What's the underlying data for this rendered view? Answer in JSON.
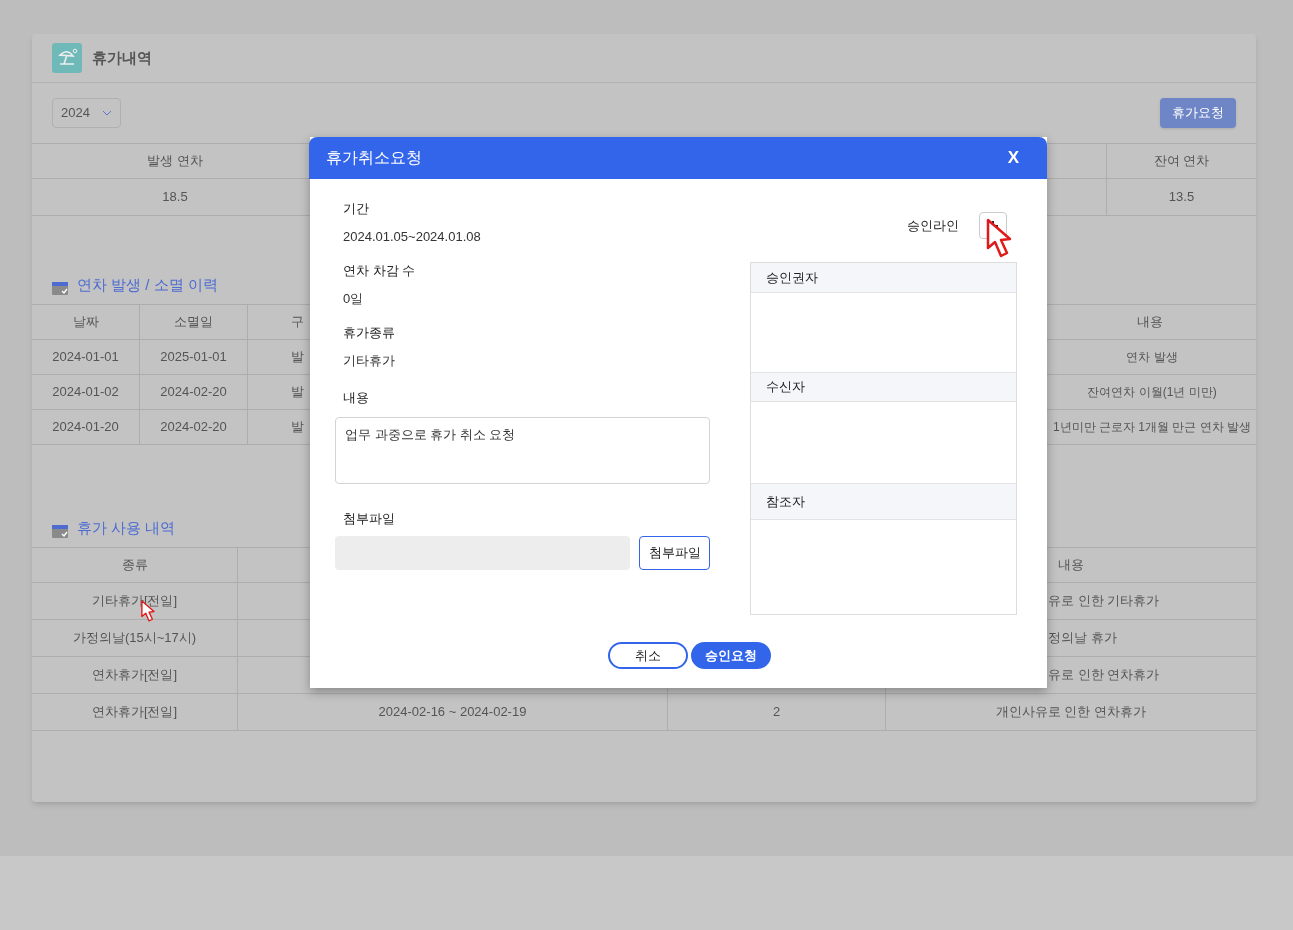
{
  "page": {
    "title": "휴가내역",
    "year": "2024",
    "request_button": "휴가요청"
  },
  "summary": {
    "first_header": "발생 연차",
    "first_value": "18.5",
    "last_header": "잔여 연차",
    "last_value": "13.5"
  },
  "history": {
    "title": "연차 발생 / 소멸 이력",
    "columns": [
      "날짜",
      "소멸일",
      "구"
    ],
    "last_column": "내용",
    "rows": [
      {
        "date": "2024-01-01",
        "expiry": "2025-01-01",
        "type": "발",
        "content": "연차 발생"
      },
      {
        "date": "2024-01-02",
        "expiry": "2024-02-20",
        "type": "발",
        "content": "잔여연차 이월(1년 미만)"
      },
      {
        "date": "2024-01-20",
        "expiry": "2024-02-20",
        "type": "발",
        "content": "1년미만 근로자 1개월 만근 연차 발생"
      }
    ]
  },
  "usage": {
    "title": "휴가 사용 내역",
    "first_column": "종류",
    "last_column": "내용",
    "rows": [
      {
        "type": "기타휴가[전일]",
        "content": "유로 인한 기타휴가"
      },
      {
        "type": "가정의날(15시~17시)",
        "content": "정의날 휴가"
      },
      {
        "type": "연차휴가[전일]",
        "content": "유로 인한 연차휴가"
      },
      {
        "type": "연차휴가[전일]",
        "period": "2024-02-16 ~ 2024-02-19",
        "days": "2",
        "content": "개인사유로 인한 연차휴가"
      }
    ]
  },
  "dialog": {
    "title": "휴가취소요청",
    "close": "X",
    "fields": [
      {
        "label": "기간",
        "value": "2024.01.05~2024.01.08"
      },
      {
        "label": "연차 차감 수",
        "value": "0일"
      },
      {
        "label": "휴가종류",
        "value": "기타휴가"
      }
    ],
    "content": {
      "label": "내용",
      "value": "업무 과중으로 휴가 취소 요청"
    },
    "attachment": {
      "label": "첨부파일",
      "button": "첨부파일"
    },
    "approval_line": {
      "label": "승인라인"
    },
    "sections": [
      "승인권자",
      "수신자",
      "참조자"
    ],
    "buttons": {
      "cancel": "취소",
      "submit": "승인요청"
    }
  }
}
